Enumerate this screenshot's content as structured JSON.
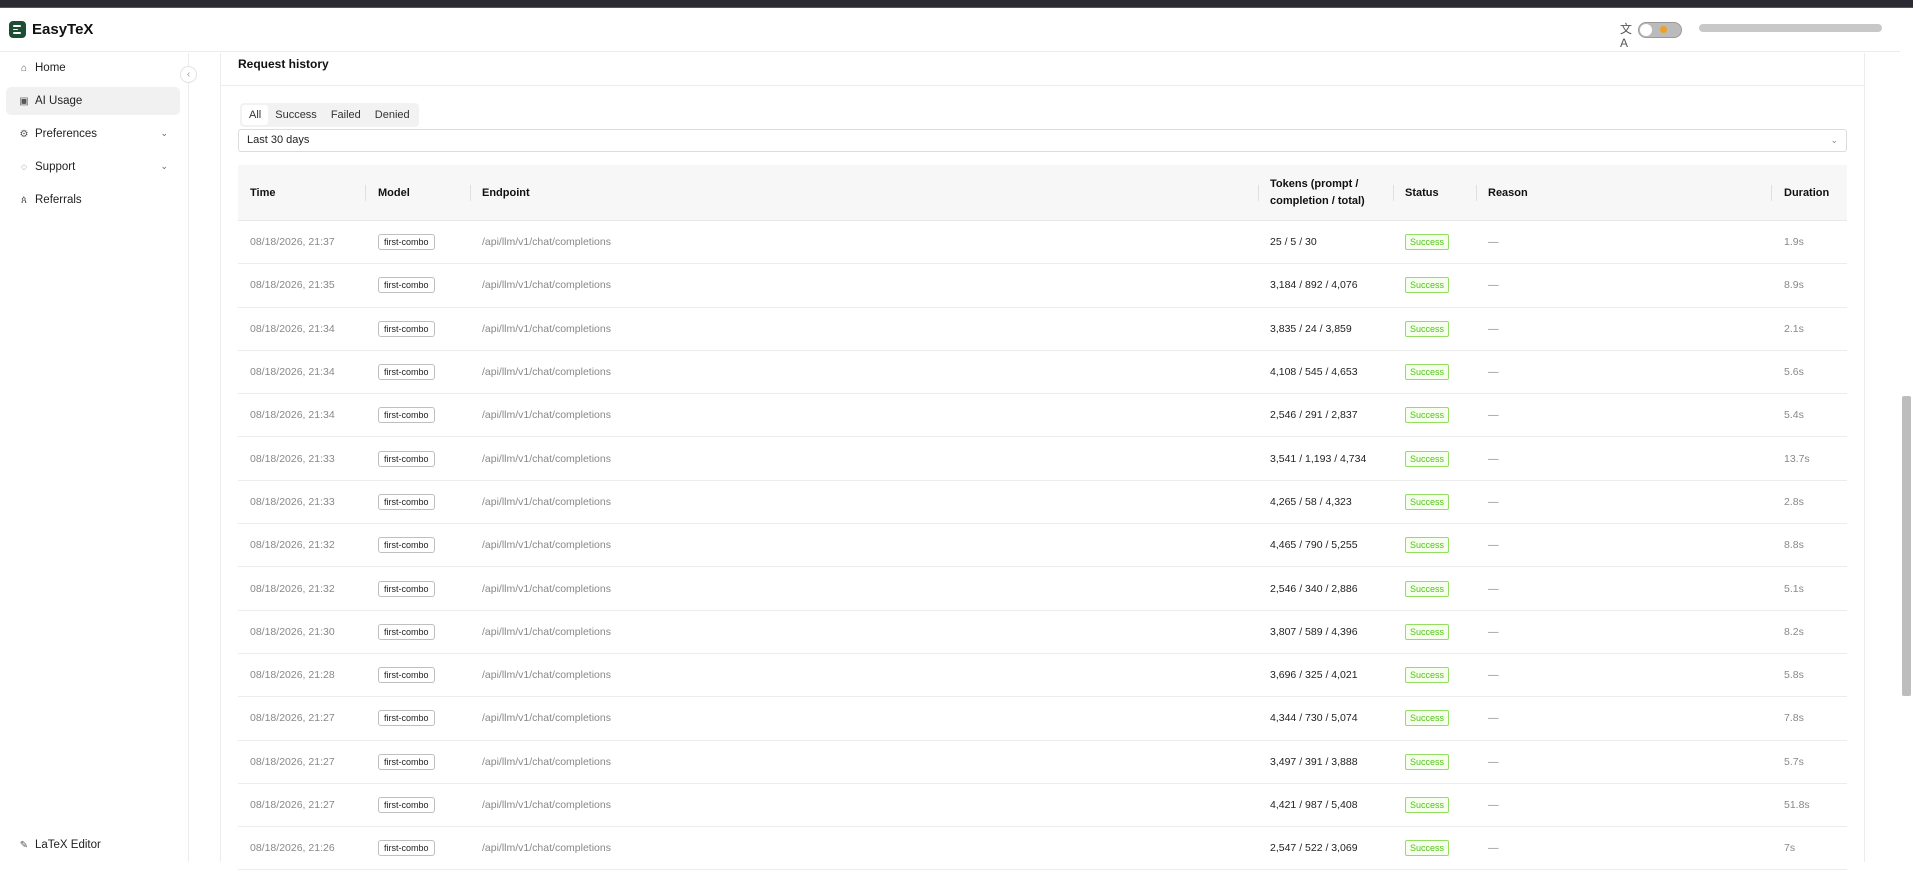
{
  "app": {
    "name": "EasyTeX"
  },
  "sidebar": {
    "items": [
      {
        "label": "Home",
        "icon": "home-icon"
      },
      {
        "label": "AI Usage",
        "icon": "usage-icon"
      },
      {
        "label": "Preferences",
        "icon": "gear-icon"
      },
      {
        "label": "Support",
        "icon": "support-icon"
      },
      {
        "label": "Referrals",
        "icon": "referrals-icon"
      }
    ],
    "footer_label": "LaTeX Editor"
  },
  "section": {
    "title": "Request history"
  },
  "tabs": [
    "All",
    "Success",
    "Failed",
    "Denied"
  ],
  "filter": {
    "range": "Last 30 days"
  },
  "table": {
    "headers": {
      "time": "Time",
      "model": "Model",
      "endpoint": "Endpoint",
      "tokens_1": "Tokens (prompt /",
      "tokens_2": "completion / total)",
      "status": "Status",
      "reason": "Reason",
      "duration": "Duration"
    },
    "rows": [
      {
        "time": "08/18/2026, 21:37",
        "model": "first-combo",
        "endpoint": "/api/llm/v1/chat/completions",
        "tokens": "25 / 5 / 30",
        "status": "Success",
        "reason": "—",
        "duration": "1.9s"
      },
      {
        "time": "08/18/2026, 21:35",
        "model": "first-combo",
        "endpoint": "/api/llm/v1/chat/completions",
        "tokens": "3,184 / 892 / 4,076",
        "status": "Success",
        "reason": "—",
        "duration": "8.9s"
      },
      {
        "time": "08/18/2026, 21:34",
        "model": "first-combo",
        "endpoint": "/api/llm/v1/chat/completions",
        "tokens": "3,835 / 24 / 3,859",
        "status": "Success",
        "reason": "—",
        "duration": "2.1s"
      },
      {
        "time": "08/18/2026, 21:34",
        "model": "first-combo",
        "endpoint": "/api/llm/v1/chat/completions",
        "tokens": "4,108 / 545 / 4,653",
        "status": "Success",
        "reason": "—",
        "duration": "5.6s"
      },
      {
        "time": "08/18/2026, 21:34",
        "model": "first-combo",
        "endpoint": "/api/llm/v1/chat/completions",
        "tokens": "2,546 / 291 / 2,837",
        "status": "Success",
        "reason": "—",
        "duration": "5.4s"
      },
      {
        "time": "08/18/2026, 21:33",
        "model": "first-combo",
        "endpoint": "/api/llm/v1/chat/completions",
        "tokens": "3,541 / 1,193 / 4,734",
        "status": "Success",
        "reason": "—",
        "duration": "13.7s"
      },
      {
        "time": "08/18/2026, 21:33",
        "model": "first-combo",
        "endpoint": "/api/llm/v1/chat/completions",
        "tokens": "4,265 / 58 / 4,323",
        "status": "Success",
        "reason": "—",
        "duration": "2.8s"
      },
      {
        "time": "08/18/2026, 21:32",
        "model": "first-combo",
        "endpoint": "/api/llm/v1/chat/completions",
        "tokens": "4,465 / 790 / 5,255",
        "status": "Success",
        "reason": "—",
        "duration": "8.8s"
      },
      {
        "time": "08/18/2026, 21:32",
        "model": "first-combo",
        "endpoint": "/api/llm/v1/chat/completions",
        "tokens": "2,546 / 340 / 2,886",
        "status": "Success",
        "reason": "—",
        "duration": "5.1s"
      },
      {
        "time": "08/18/2026, 21:30",
        "model": "first-combo",
        "endpoint": "/api/llm/v1/chat/completions",
        "tokens": "3,807 / 589 / 4,396",
        "status": "Success",
        "reason": "—",
        "duration": "8.2s"
      },
      {
        "time": "08/18/2026, 21:28",
        "model": "first-combo",
        "endpoint": "/api/llm/v1/chat/completions",
        "tokens": "3,696 / 325 / 4,021",
        "status": "Success",
        "reason": "—",
        "duration": "5.8s"
      },
      {
        "time": "08/18/2026, 21:27",
        "model": "first-combo",
        "endpoint": "/api/llm/v1/chat/completions",
        "tokens": "4,344 / 730 / 5,074",
        "status": "Success",
        "reason": "—",
        "duration": "7.8s"
      },
      {
        "time": "08/18/2026, 21:27",
        "model": "first-combo",
        "endpoint": "/api/llm/v1/chat/completions",
        "tokens": "3,497 / 391 / 3,888",
        "status": "Success",
        "reason": "—",
        "duration": "5.7s"
      },
      {
        "time": "08/18/2026, 21:27",
        "model": "first-combo",
        "endpoint": "/api/llm/v1/chat/completions",
        "tokens": "4,421 / 987 / 5,408",
        "status": "Success",
        "reason": "—",
        "duration": "51.8s"
      },
      {
        "time": "08/18/2026, 21:26",
        "model": "first-combo",
        "endpoint": "/api/llm/v1/chat/completions",
        "tokens": "2,547 / 522 / 3,069",
        "status": "Success",
        "reason": "—",
        "duration": "7s"
      }
    ]
  },
  "colors": {
    "brand": "#1d4d35",
    "success_text": "#52c41a",
    "success_border": "#95de64",
    "success_bg": "#f6ffed"
  }
}
